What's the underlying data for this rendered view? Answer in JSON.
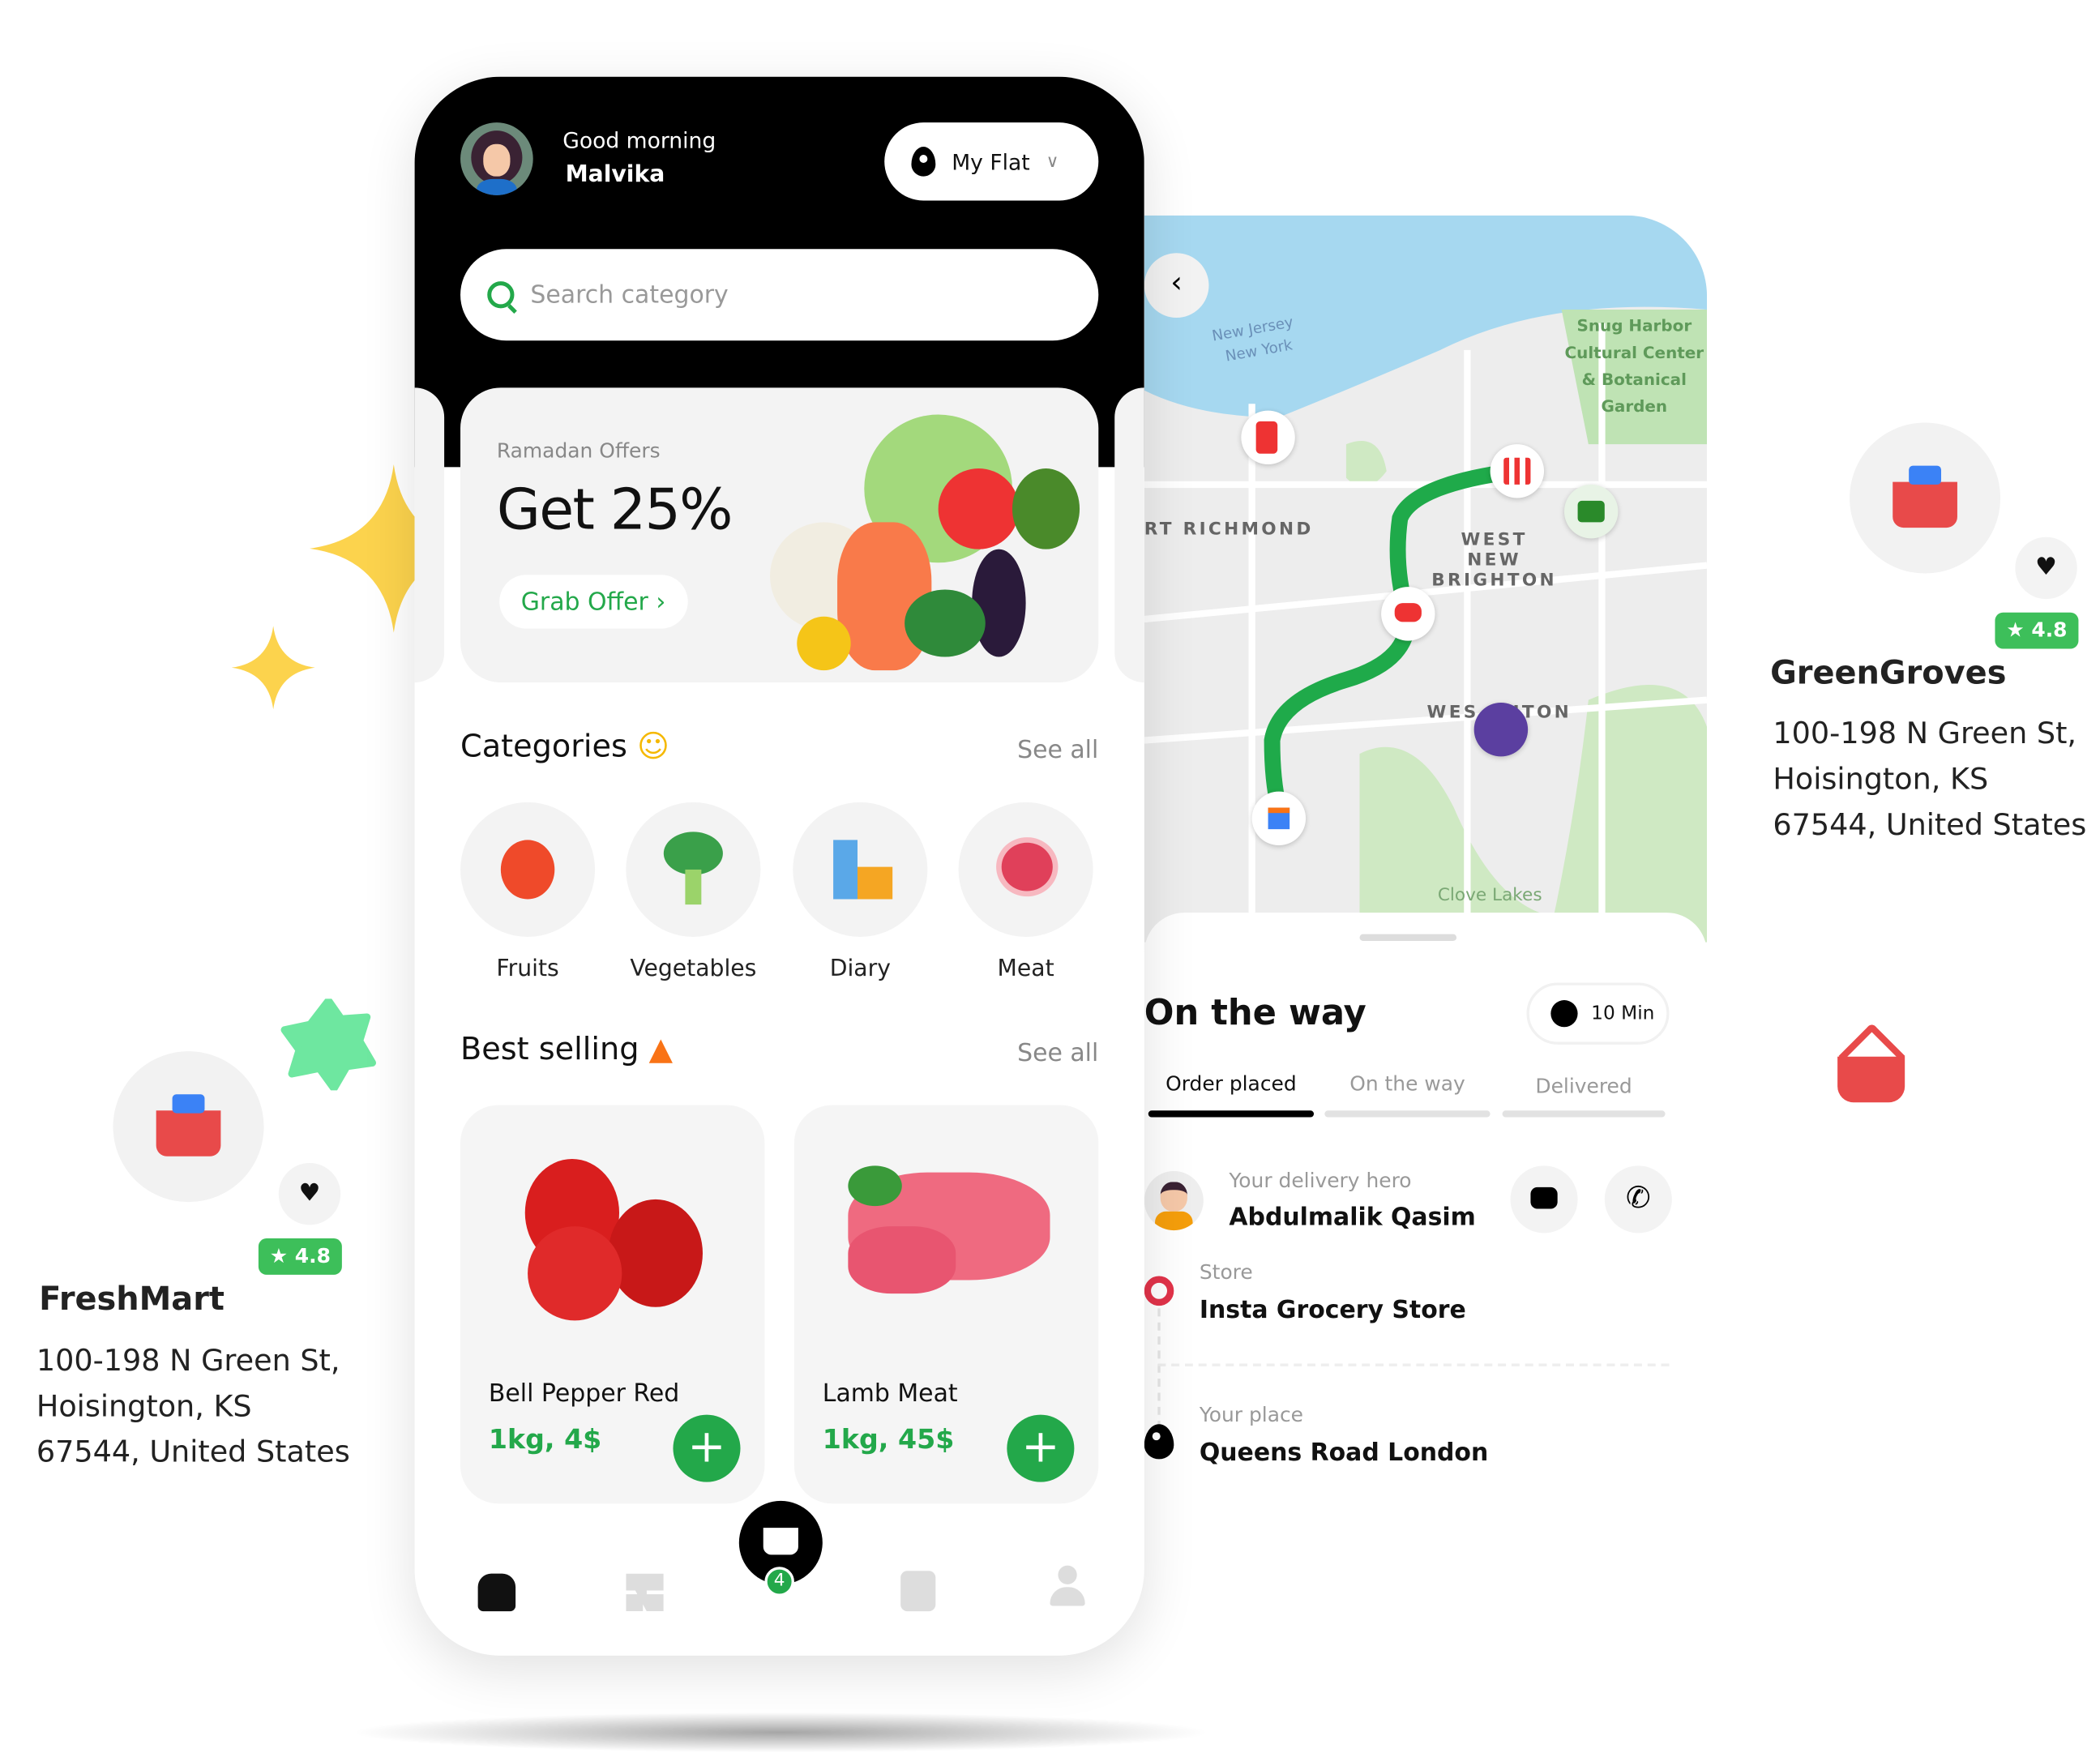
{
  "home": {
    "greeting": "Good morning",
    "user_name": "Malvika",
    "location": "My Flat",
    "search_placeholder": "Search category",
    "banner": {
      "subtitle": "Ramadan Offers",
      "title": "Get 25%",
      "button": "Grab Offer ›"
    },
    "categories": {
      "title": "Categories",
      "see_all": "See all",
      "items": [
        {
          "label": "Fruits"
        },
        {
          "label": "Vegetables"
        },
        {
          "label": "Diary"
        },
        {
          "label": "Meat"
        }
      ]
    },
    "best_selling": {
      "title": "Best selling",
      "see_all": "See all",
      "items": [
        {
          "name": "Bell Pepper Red",
          "price": "1kg, 4$"
        },
        {
          "name": "Lamb Meat",
          "price": "1kg, 45$"
        }
      ]
    },
    "nav": {
      "cart_count": "4",
      "icons": [
        "home-icon",
        "grid-icon",
        "basket-icon",
        "calendar-icon",
        "profile-icon"
      ]
    }
  },
  "tracking": {
    "map_labels": [
      "New Jersey",
      "New York",
      "Snug Harbor Cultural Center & Botanical Garden",
      "RT RICHMOND",
      "WEST NEW BRIGHTON",
      "WES  GHTON",
      "Clove Lakes"
    ],
    "title": "On the way",
    "eta": "10 Min",
    "steps": [
      {
        "label": "Order placed",
        "active": true
      },
      {
        "label": "On the way",
        "active": false
      },
      {
        "label": "Delivered",
        "active": false
      }
    ],
    "hero_label": "Your delivery hero",
    "hero_name": "Abdulmalik Qasim",
    "store_label": "Store",
    "store_name": "Insta Grocery Store",
    "place_label": "Your place",
    "place_name": "Queens Road London"
  },
  "stores": [
    {
      "name": "GreenGroves",
      "rating": "★ 4.8",
      "address": [
        "100-198 N Green St,",
        "Hoisington, KS",
        "67544, United States"
      ]
    },
    {
      "name": "FreshMart",
      "rating": "★ 4.8",
      "address": [
        "100-198 N Green St,",
        "Hoisington, KS",
        "67544, United States"
      ]
    }
  ],
  "colors": {
    "accent": "#23a84a",
    "rating": "#3dbf5a",
    "star": "#fcd34d",
    "basket": "#e84a4a",
    "route": "#1faa4a"
  }
}
